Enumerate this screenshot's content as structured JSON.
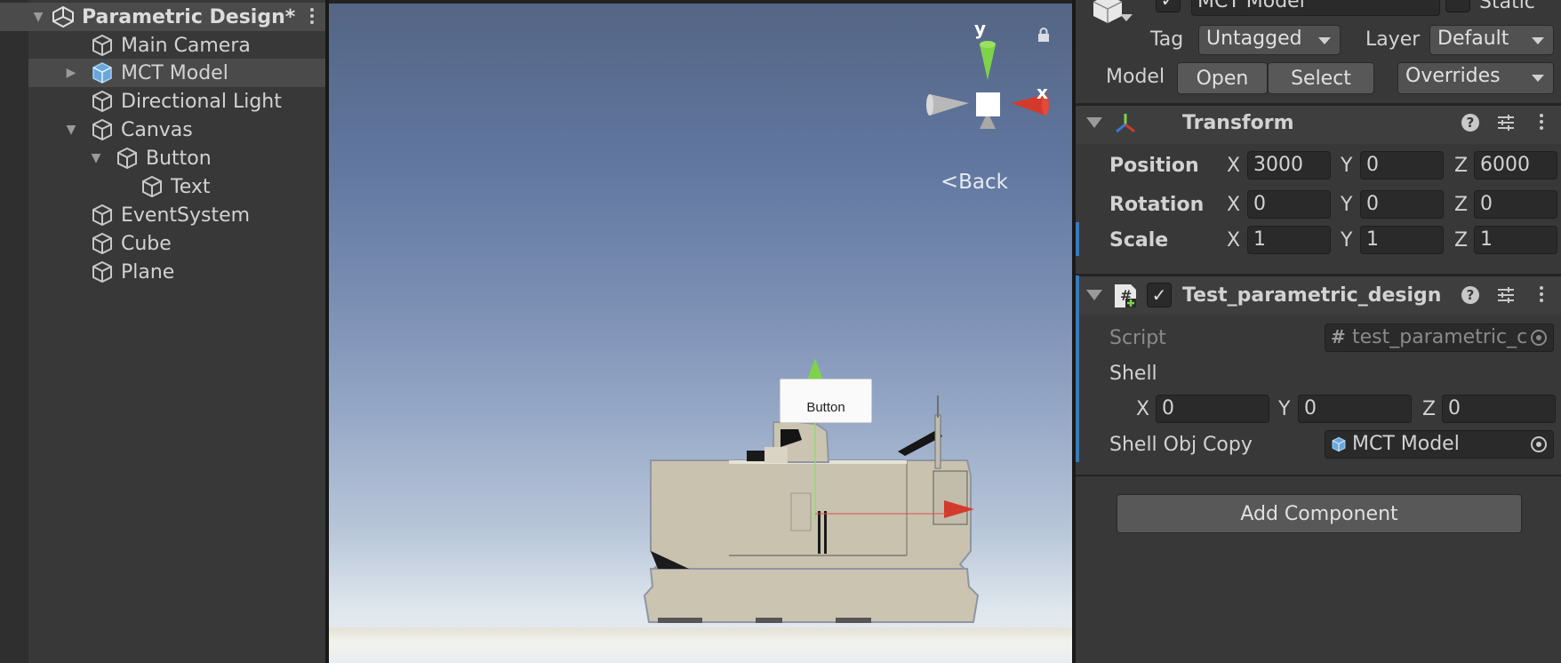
{
  "hierarchy": {
    "scene_name": "Parametric Design*",
    "items": [
      {
        "label": "Main Camera"
      },
      {
        "label": "MCT Model"
      },
      {
        "label": "Directional Light"
      },
      {
        "label": "Canvas"
      },
      {
        "label": "Button"
      },
      {
        "label": "Text"
      },
      {
        "label": "EventSystem"
      },
      {
        "label": "Cube"
      },
      {
        "label": "Plane"
      }
    ]
  },
  "scene": {
    "gizmo_y": "y",
    "gizmo_x": "x",
    "back_label": "Back",
    "ui_button_label": "Button"
  },
  "inspector": {
    "object_name": "MCT Model",
    "static_label": "Static",
    "tag_label": "Tag",
    "tag_value": "Untagged",
    "layer_label": "Layer",
    "layer_value": "Default",
    "model_label": "Model",
    "open_label": "Open",
    "select_label": "Select",
    "overrides_label": "Overrides",
    "transform": {
      "title": "Transform",
      "position_label": "Position",
      "rotation_label": "Rotation",
      "scale_label": "Scale",
      "axis_x": "X",
      "axis_y": "Y",
      "axis_z": "Z",
      "position": {
        "x": "3000",
        "y": "0",
        "z": "6000"
      },
      "rotation": {
        "x": "0",
        "y": "0",
        "z": "0"
      },
      "scale": {
        "x": "1",
        "y": "1",
        "z": "1"
      }
    },
    "script_component": {
      "title": "Test_parametric_design (",
      "checked_mark": "✓",
      "script_label": "Script",
      "script_value": "test_parametric_c",
      "shell_label": "Shell",
      "shell": {
        "x": "0",
        "y": "0",
        "z": "0"
      },
      "shell_obj_copy_label": "Shell Obj Copy",
      "shell_obj_copy_value": "MCT Model"
    },
    "add_component_label": "Add Component"
  },
  "colors": {
    "panel_bg": "#383838",
    "field_bg": "#2a2a2a",
    "accent_blue": "#3a79bb",
    "gizmo_y": "#7ed348",
    "gizmo_x": "#d33a2c"
  }
}
